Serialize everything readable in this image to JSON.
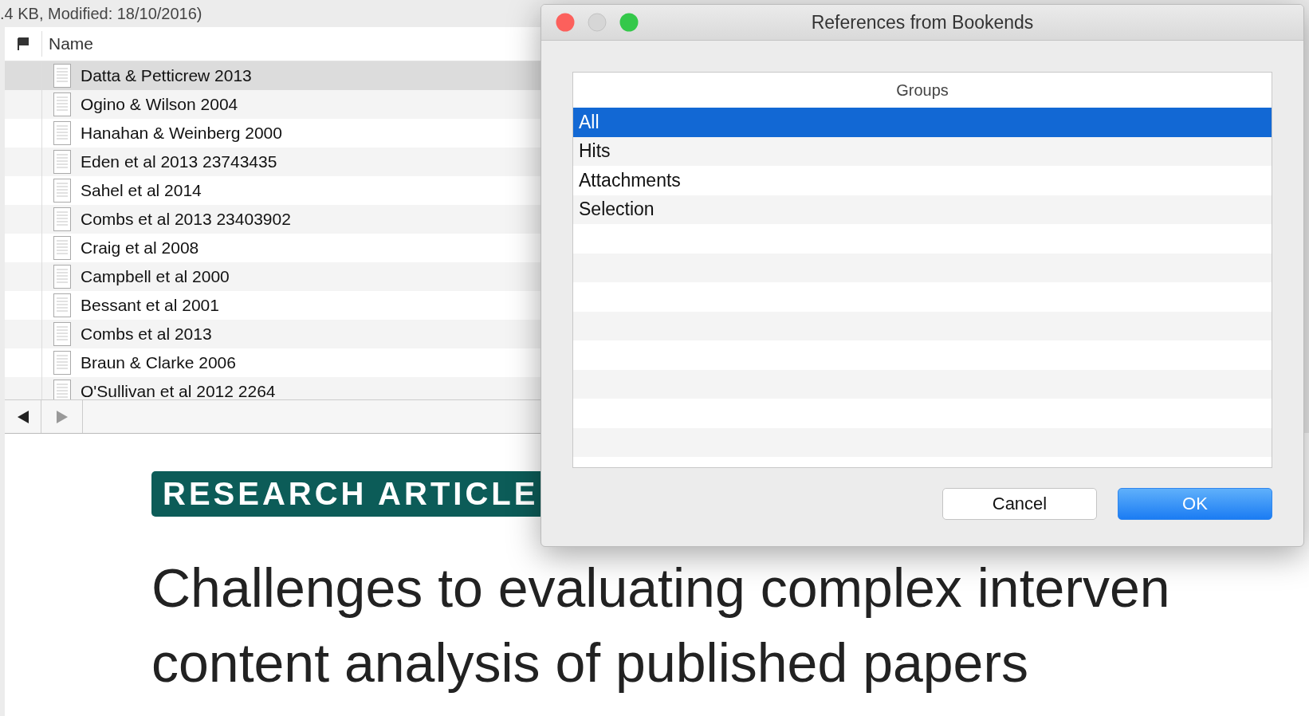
{
  "status_text": ".4 KB, Modified: 18/10/2016)",
  "file_list": {
    "columns": [
      "Name"
    ],
    "rows": [
      {
        "name": "Datta & Petticrew 2013",
        "selected": true
      },
      {
        "name": "Ogino & Wilson 2004",
        "selected": false
      },
      {
        "name": "Hanahan & Weinberg 2000",
        "selected": false
      },
      {
        "name": "Eden et al 2013 23743435",
        "selected": false
      },
      {
        "name": "Sahel et al 2014",
        "selected": false
      },
      {
        "name": "Combs et al 2013 23403902",
        "selected": false
      },
      {
        "name": "Craig et al 2008",
        "selected": false
      },
      {
        "name": "Campbell et al 2000",
        "selected": false
      },
      {
        "name": "Bessant et al 2001",
        "selected": false
      },
      {
        "name": "Combs et al 2013",
        "selected": false
      },
      {
        "name": "Braun & Clarke 2006",
        "selected": false
      },
      {
        "name": "O'Sullivan et al 2012 2264",
        "selected": false
      }
    ]
  },
  "document": {
    "badge": "RESEARCH ARTICLE",
    "title_lines": [
      "Challenges to evaluating complex interven",
      "content analysis of published papers"
    ]
  },
  "dialog": {
    "title": "References from Bookends",
    "table": {
      "header": "Groups",
      "rows": [
        {
          "label": "All",
          "selected": true
        },
        {
          "label": "Hits",
          "selected": false
        },
        {
          "label": "Attachments",
          "selected": false
        },
        {
          "label": "Selection",
          "selected": false
        }
      ]
    },
    "buttons": [
      {
        "label": "Cancel",
        "kind": "secondary"
      },
      {
        "label": "OK",
        "kind": "default"
      }
    ]
  }
}
